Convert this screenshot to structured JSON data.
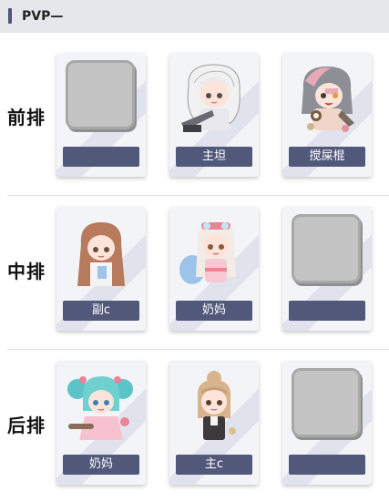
{
  "header": {
    "title": "PVP—"
  },
  "rows": [
    {
      "label": "前排",
      "slots": [
        {
          "name": "",
          "empty": true
        },
        {
          "name": "主坦",
          "empty": false
        },
        {
          "name": "搅屎棍",
          "empty": false
        }
      ]
    },
    {
      "label": "中排",
      "slots": [
        {
          "name": "副c",
          "empty": false
        },
        {
          "name": "奶妈",
          "empty": false
        },
        {
          "name": "",
          "empty": true
        }
      ]
    },
    {
      "label": "后排",
      "slots": [
        {
          "name": "奶妈",
          "empty": false
        },
        {
          "name": "主c",
          "empty": false
        },
        {
          "name": "",
          "empty": true
        }
      ]
    }
  ],
  "colors": {
    "header_bg": "#e6e7ea",
    "accent": "#52587a",
    "card_bg": "#f3f4f7",
    "empty_slot": "#c4c4c4"
  }
}
